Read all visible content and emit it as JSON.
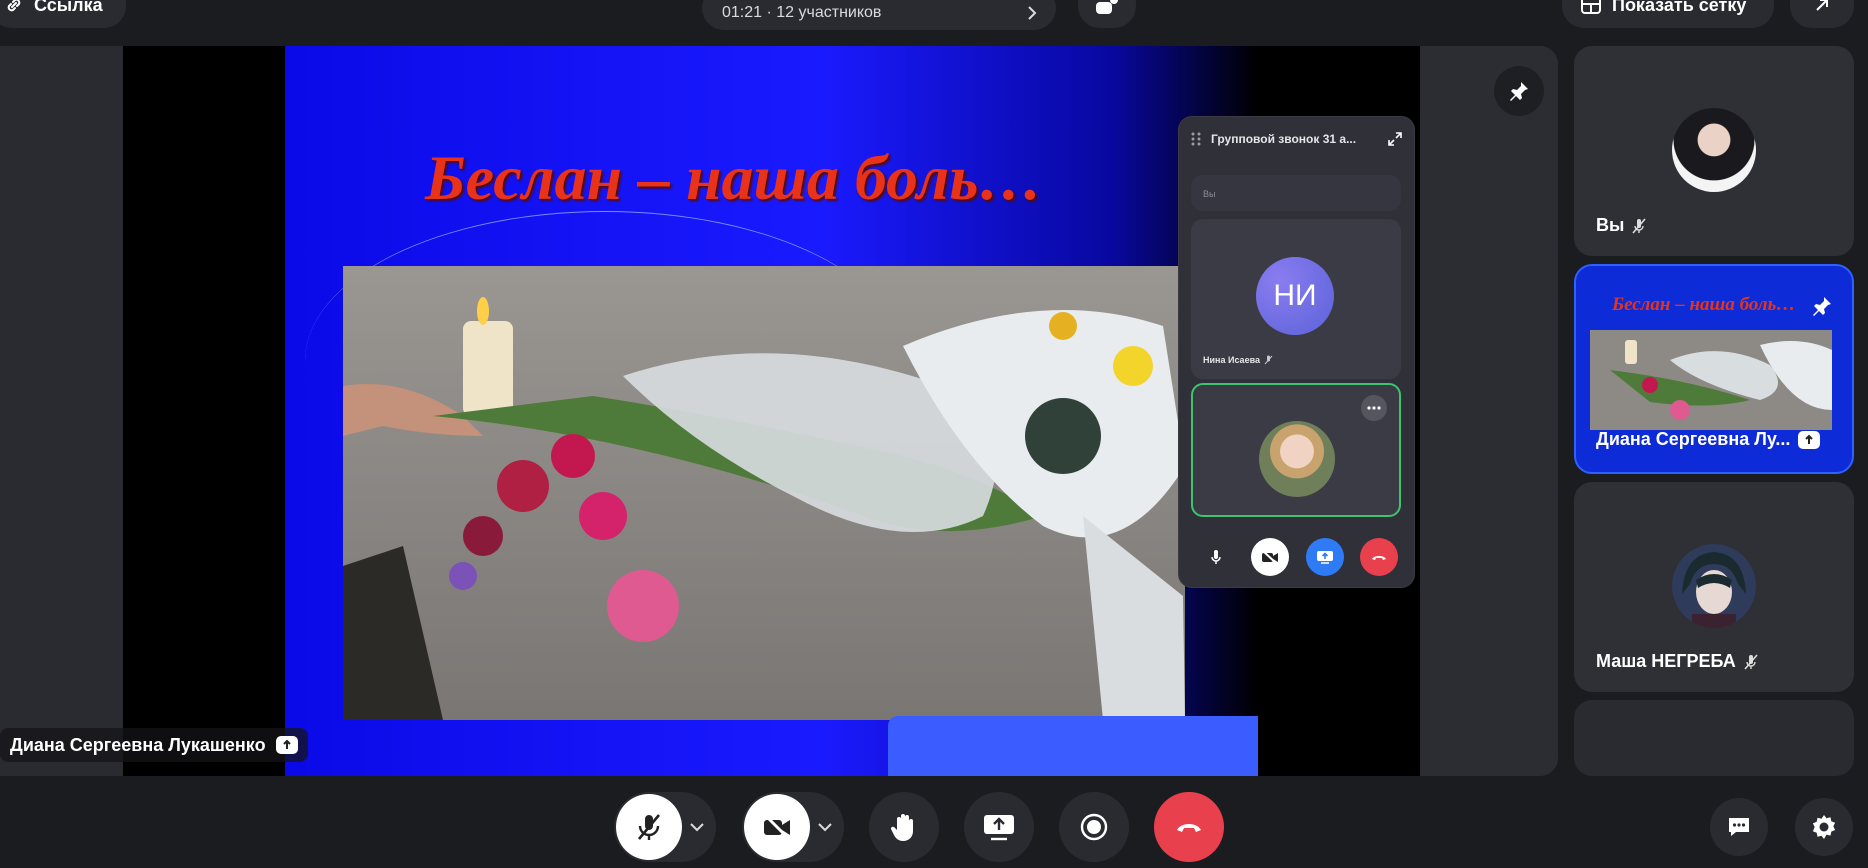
{
  "top_bar": {
    "link_label": "Ссылка",
    "call_info": "01:21 · 12 участников",
    "show_grid_label": "Показать сетку"
  },
  "stage": {
    "slide_title": "Беслан – наша боль…",
    "speaker_name": "Диана Сергеевна Лукашенко"
  },
  "mini_window": {
    "title": "Групповой звонок 31 а...",
    "you_label": "Вы",
    "ni_initials": "НИ",
    "ni_name": "Нина Исаева"
  },
  "participants": [
    {
      "name": "Вы",
      "muted": true
    },
    {
      "name": "Диана Сергеевна Лу...",
      "sharing": true,
      "slide_title": "Беслан – наша боль…"
    },
    {
      "name": "Маша НЕГРЕБА",
      "muted": true
    }
  ],
  "colors": {
    "accent_blue": "#2f7bf6",
    "end_call_red": "#e8414d",
    "speaking_green": "#3ec46b",
    "slide_title_red": "#e8321a"
  }
}
